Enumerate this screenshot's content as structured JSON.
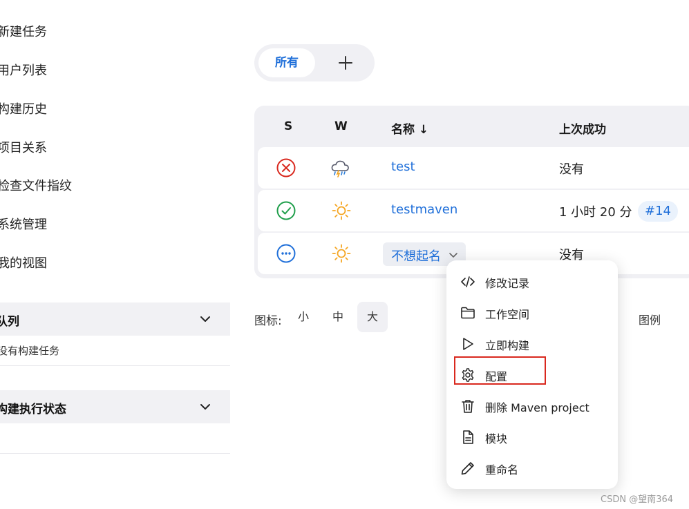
{
  "sidebar": {
    "links": [
      "新建任务",
      "用户列表",
      "构建历史",
      "项目关系",
      "检查文件指纹",
      "系统管理",
      "我的视图"
    ],
    "sections": [
      {
        "title": "队列",
        "text": "没有构建任务"
      },
      {
        "title": "构建执行状态",
        "text": ""
      }
    ]
  },
  "tabs": {
    "all": "所有",
    "add": "+"
  },
  "table": {
    "headers": {
      "s": "S",
      "w": "W",
      "name": "名称 ↓",
      "last_success": "上次成功"
    },
    "rows": [
      {
        "status": "failed",
        "weather": "stormy",
        "name": "test",
        "last_success": "没有",
        "build": ""
      },
      {
        "status": "success",
        "weather": "sunny",
        "name": "testmaven",
        "last_success": "1 小时 20 分",
        "build": "#14"
      },
      {
        "status": "not-built",
        "weather": "sunny",
        "name": "不想起名",
        "last_success": "没有",
        "build": ""
      }
    ]
  },
  "icon_size": {
    "label": "图标:",
    "options": [
      "小",
      "中",
      "大"
    ],
    "selected": "大"
  },
  "legend": "图例",
  "menu": {
    "items": [
      {
        "icon": "code-icon",
        "label": "修改记录"
      },
      {
        "icon": "folder-icon",
        "label": "工作空间"
      },
      {
        "icon": "play-icon",
        "label": "立即构建"
      },
      {
        "icon": "gear-icon",
        "label": "配置"
      },
      {
        "icon": "trash-icon",
        "label": "删除 Maven project"
      },
      {
        "icon": "document-icon",
        "label": "模块"
      },
      {
        "icon": "pencil-icon",
        "label": "重命名"
      }
    ]
  },
  "colors": {
    "accent": "#1f6fd9",
    "success": "#1e9e4a",
    "failure": "#d9281e",
    "highlight": "#d9281e"
  },
  "watermark": "CSDN @望南364"
}
